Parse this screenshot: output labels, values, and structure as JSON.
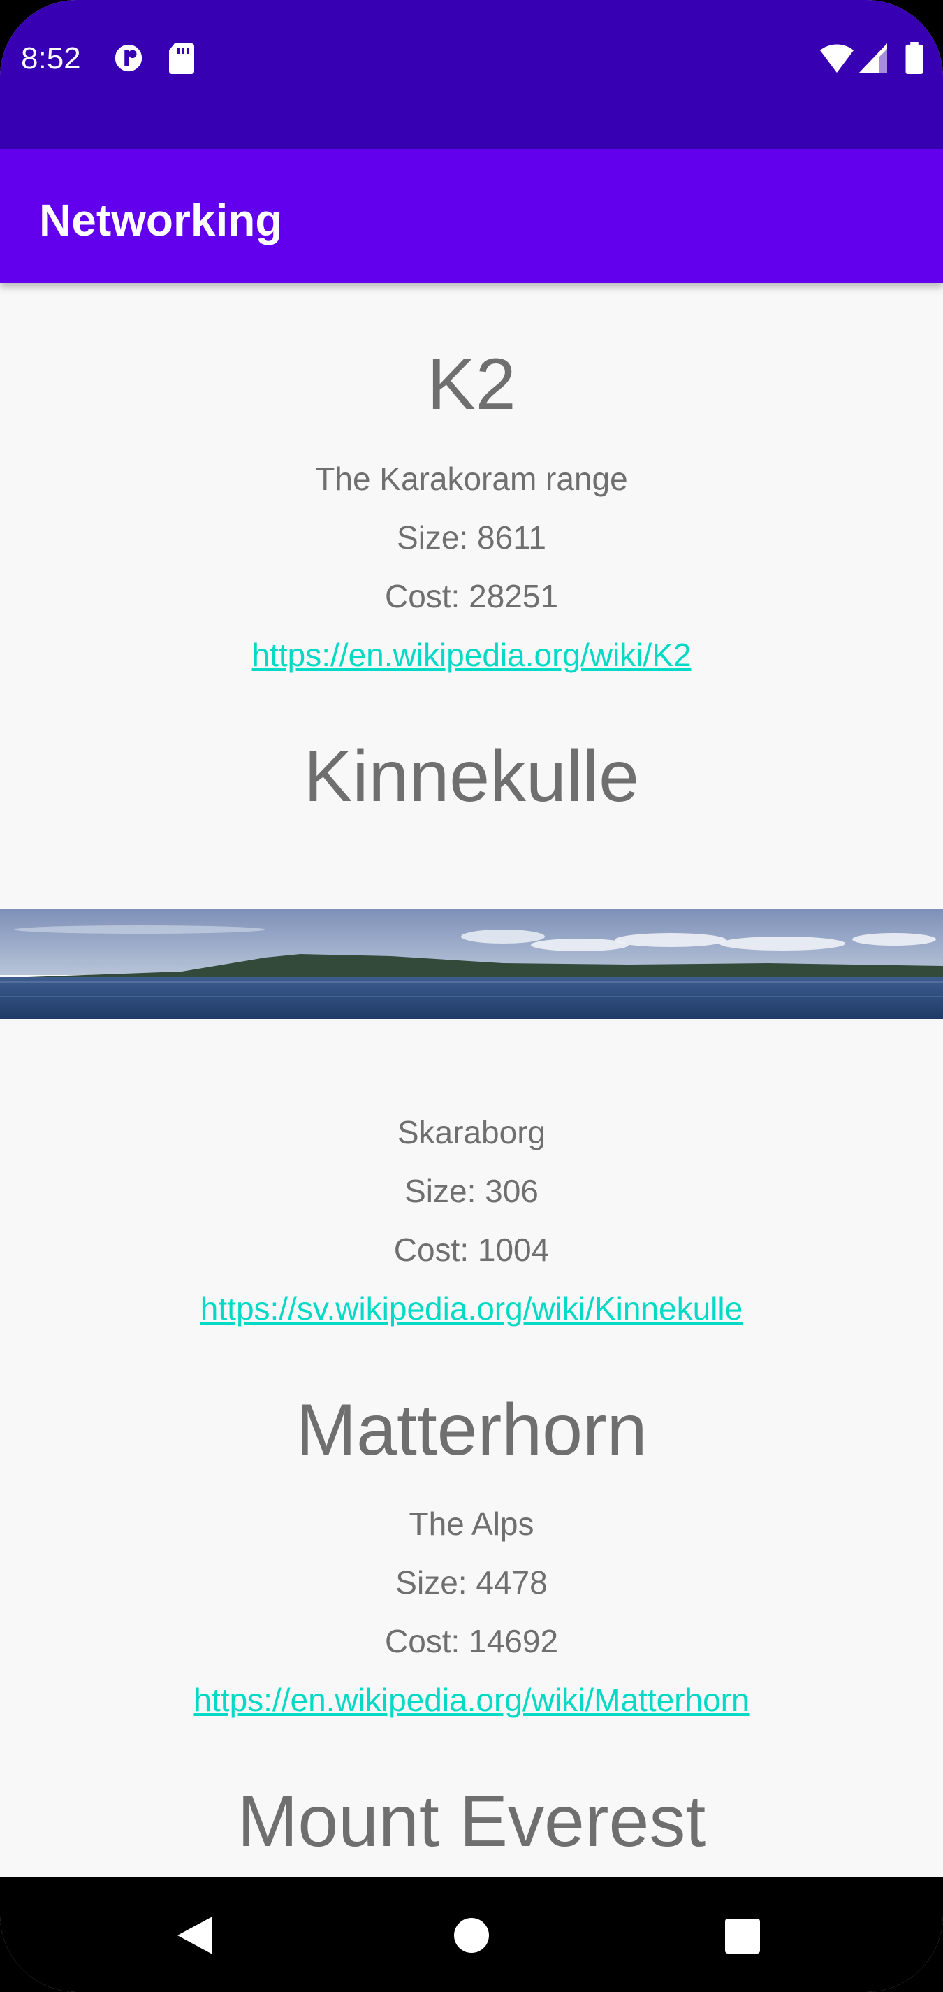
{
  "status_bar": {
    "time": "8:52",
    "left_icons": [
      "data-saver-icon",
      "sd-card-icon"
    ],
    "right_icons": [
      "wifi-icon",
      "cellular-signal-icon",
      "battery-icon"
    ]
  },
  "app_bar": {
    "title": "Networking"
  },
  "mountains": [
    {
      "name": "K2",
      "location": "The Karakoram range",
      "size": "Size: 8611",
      "cost": "Cost: 28251",
      "url": "https://en.wikipedia.org/wiki/K2"
    },
    {
      "name": "Kinnekulle",
      "image": "kinnekulle-lake-panorama",
      "location": "Skaraborg",
      "size": "Size: 306",
      "cost": "Cost: 1004",
      "url": "https://sv.wikipedia.org/wiki/Kinnekulle"
    },
    {
      "name": "Matterhorn",
      "location": "The Alps",
      "size": "Size: 4478",
      "cost": "Cost: 14692",
      "url": "https://en.wikipedia.org/wiki/Matterhorn"
    },
    {
      "name": "Mount Everest"
    }
  ],
  "nav_bar": {
    "icons": [
      "back-icon",
      "home-icon",
      "recents-icon"
    ]
  },
  "colors": {
    "status_bar": "#3700b3",
    "app_bar": "#6200ee",
    "link": "#03dac5",
    "text": "#6f6f6f",
    "background": "#f8f8f8"
  }
}
